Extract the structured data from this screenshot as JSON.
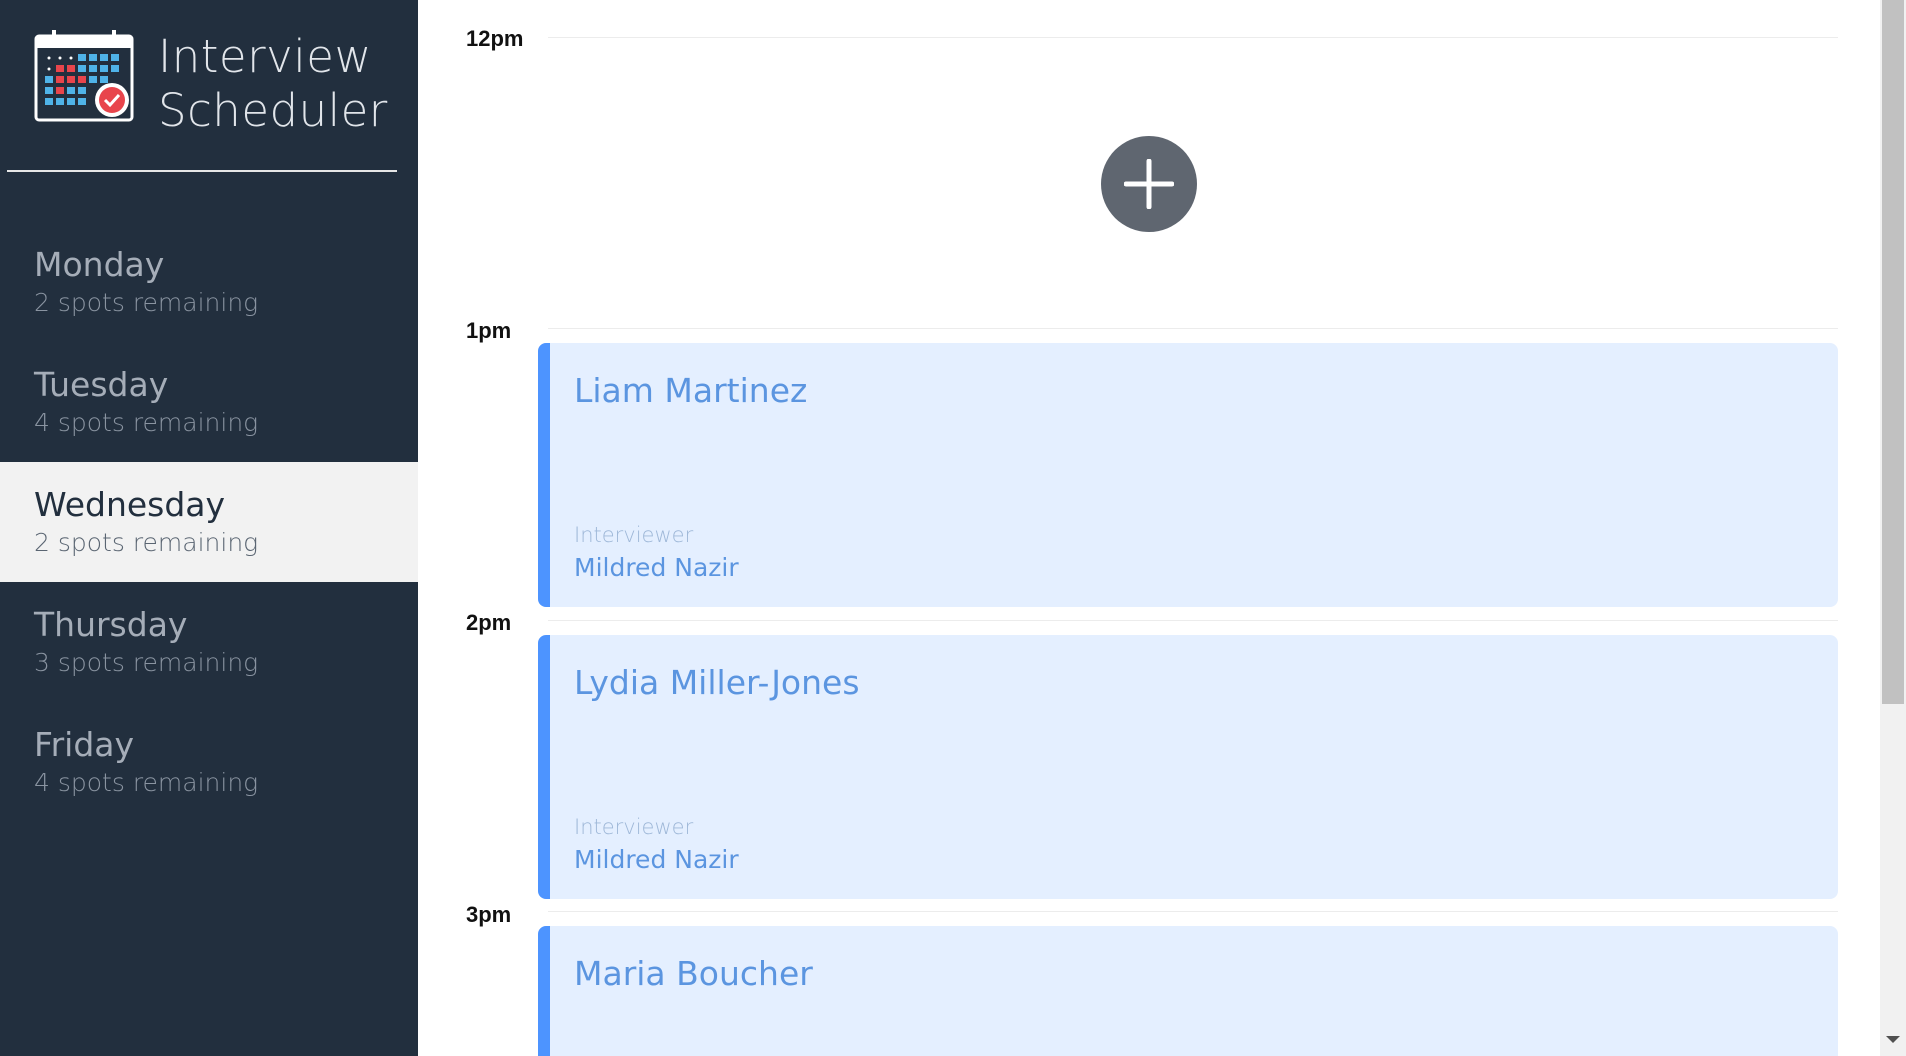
{
  "app": {
    "title_line1": "Interview",
    "title_line2": "Scheduler"
  },
  "sidebar": {
    "days": [
      {
        "name": "Monday",
        "spots": "2 spots remaining",
        "selected": false
      },
      {
        "name": "Tuesday",
        "spots": "4 spots remaining",
        "selected": false
      },
      {
        "name": "Wednesday",
        "spots": "2 spots remaining",
        "selected": true
      },
      {
        "name": "Thursday",
        "spots": "3 spots remaining",
        "selected": false
      },
      {
        "name": "Friday",
        "spots": "4 spots remaining",
        "selected": false
      }
    ]
  },
  "schedule": {
    "times": [
      "12pm",
      "1pm",
      "2pm",
      "3pm"
    ],
    "appointments": [
      {
        "student": "Liam Martinez",
        "interviewer_label": "Interviewer",
        "interviewer": "Mildred Nazir"
      },
      {
        "student": "Lydia Miller-Jones",
        "interviewer_label": "Interviewer",
        "interviewer": "Mildred Nazir"
      },
      {
        "student": "Maria Boucher"
      }
    ],
    "add_button_icon": "plus-icon"
  },
  "colors": {
    "sidebar_bg": "#222f3e",
    "selected_bg": "#f2f2f2",
    "appointment_bg": "#e4efff",
    "appointment_accent": "#4d94ff",
    "add_button": "#5f6670"
  }
}
